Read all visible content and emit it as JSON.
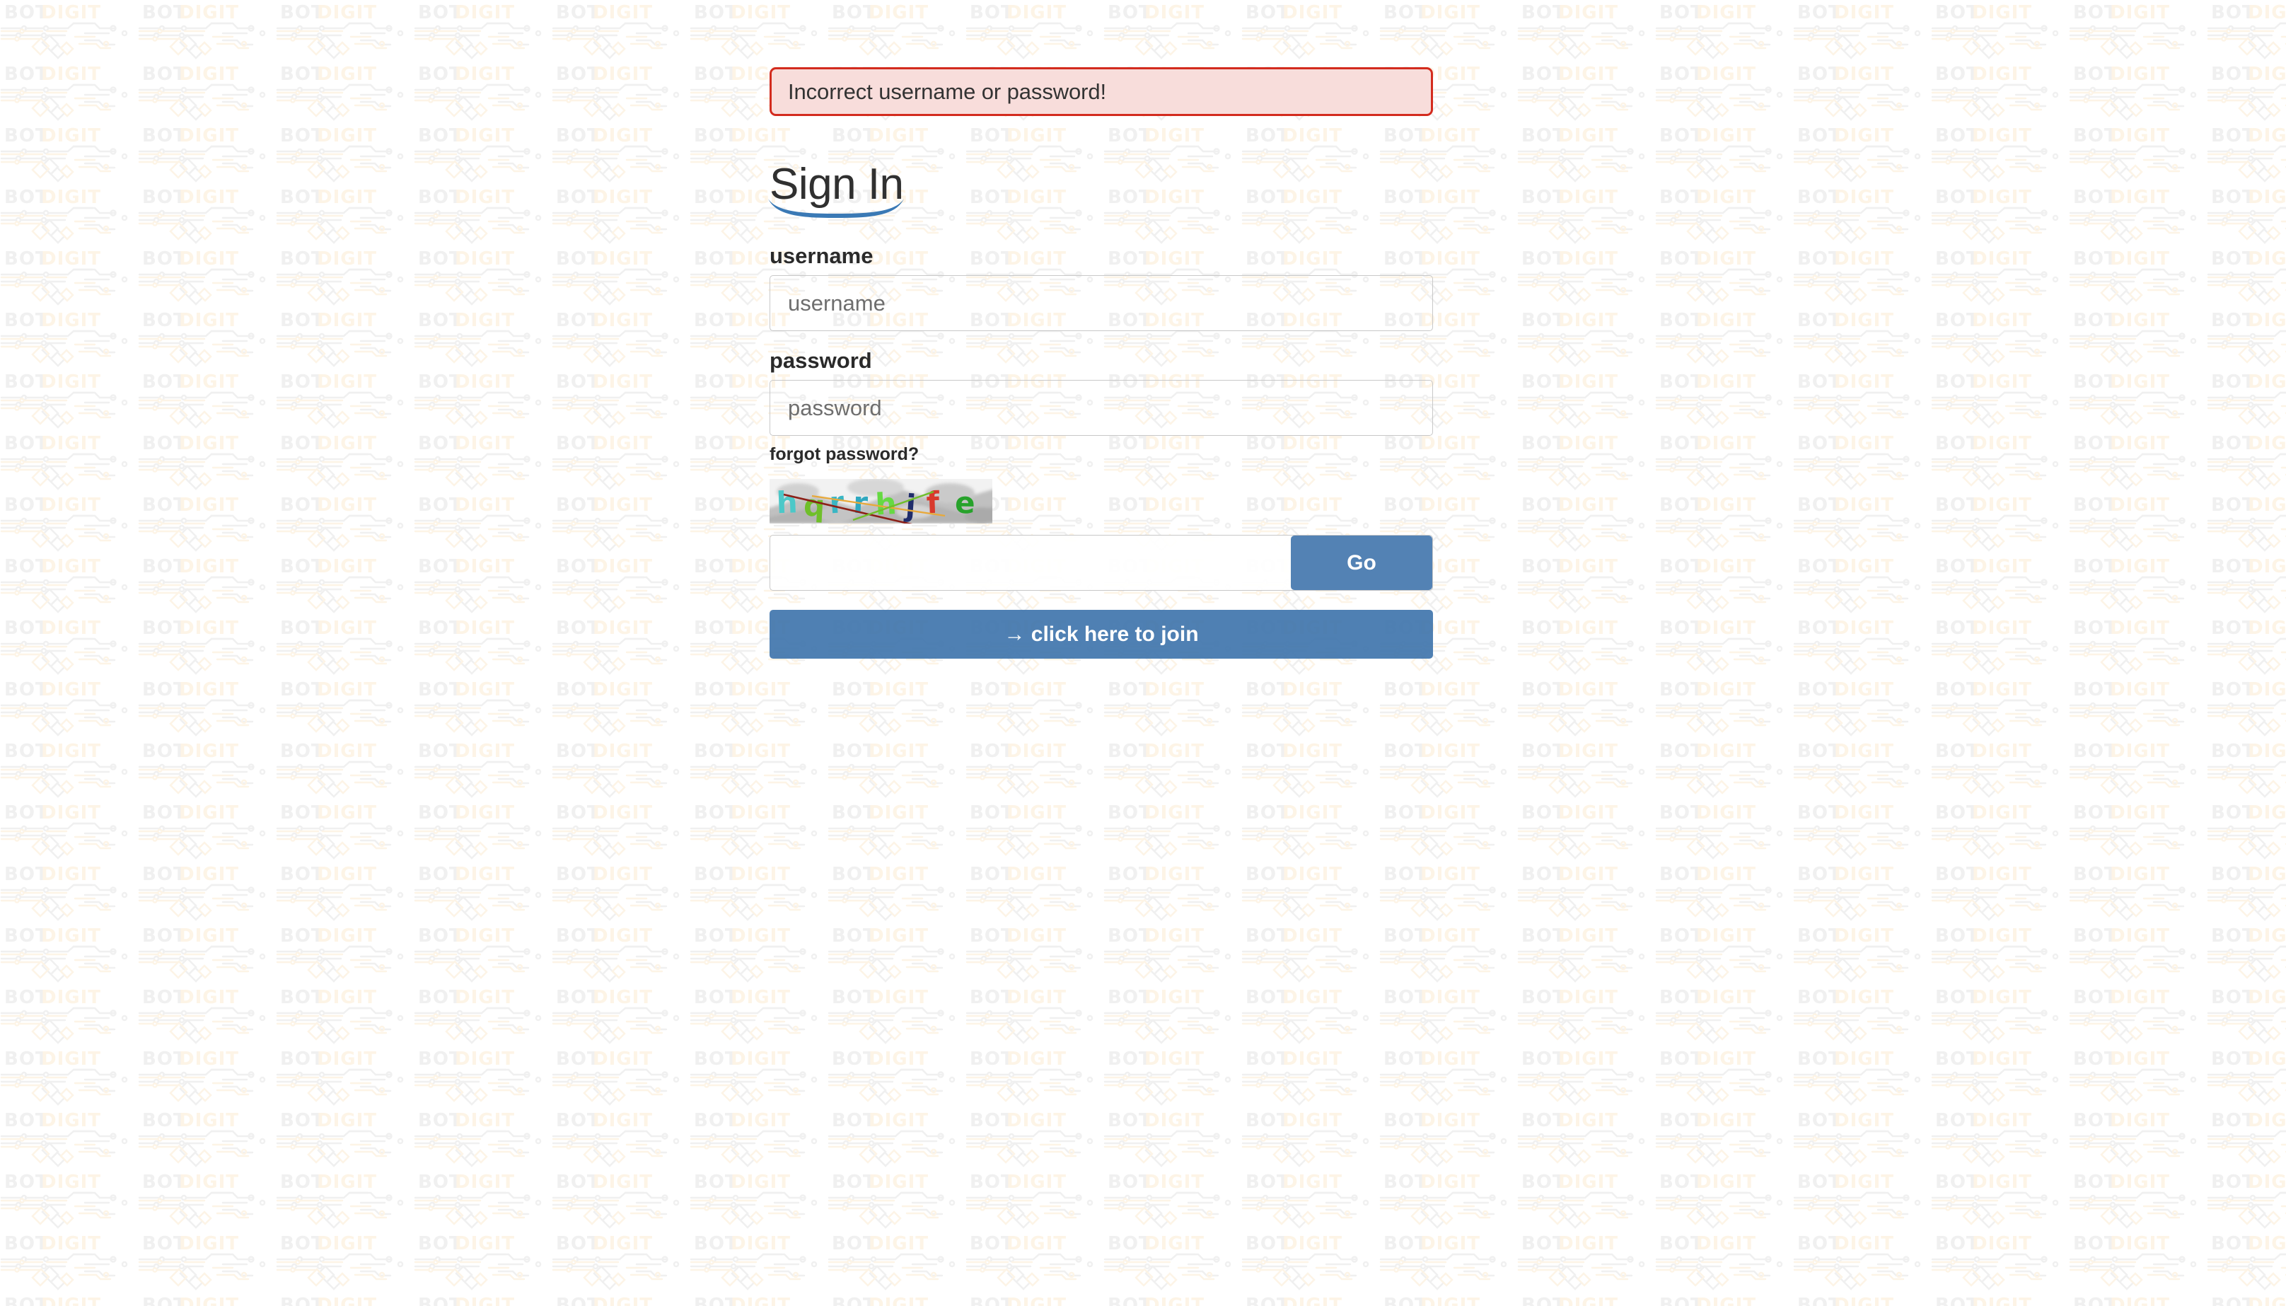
{
  "background": {
    "watermark_text_primary": "BOT",
    "watermark_text_secondary": "DIGIT",
    "watermark_color_primary": "#f0f0f0",
    "watermark_color_secondary": "#fdf4e6",
    "page_background": "#ffffff"
  },
  "alert": {
    "message": "Incorrect username or password!",
    "border_color": "#d32b1e",
    "background_color": "#f8dddb",
    "text_color": "#333333"
  },
  "heading": {
    "title": "Sign In",
    "underline_color": "#3a79b5"
  },
  "fields": {
    "username": {
      "label": "username",
      "placeholder": "username",
      "value": ""
    },
    "password": {
      "label": "password",
      "placeholder": "password",
      "value": ""
    },
    "captcha": {
      "placeholder": "",
      "value": ""
    }
  },
  "links": {
    "forgot_password": "forgot password?"
  },
  "captcha": {
    "text": "hqrrhjfe",
    "characters": [
      {
        "glyph": "h",
        "color": "#4cc8c8"
      },
      {
        "glyph": "q",
        "color": "#6fbf2a"
      },
      {
        "glyph": "r",
        "color": "#3ab6c4"
      },
      {
        "glyph": "r",
        "color": "#2fa8c0"
      },
      {
        "glyph": "h",
        "color": "#66d943"
      },
      {
        "glyph": "j",
        "color": "#1f2d6b"
      },
      {
        "glyph": "f",
        "color": "#d8392c"
      },
      {
        "glyph": "e",
        "color": "#27a22b"
      }
    ],
    "strike_lines": [
      {
        "color": "#8c2018"
      },
      {
        "color": "#e8a93a"
      },
      {
        "color": "#6fbf2a"
      }
    ],
    "noise_background": "#c9c9c9"
  },
  "buttons": {
    "go": {
      "label": "Go",
      "color": "#376ea8",
      "text_color": "#ffffff"
    },
    "join": {
      "label": "→ click here to join",
      "color": "#376ea8",
      "text_color": "#ffffff"
    }
  }
}
